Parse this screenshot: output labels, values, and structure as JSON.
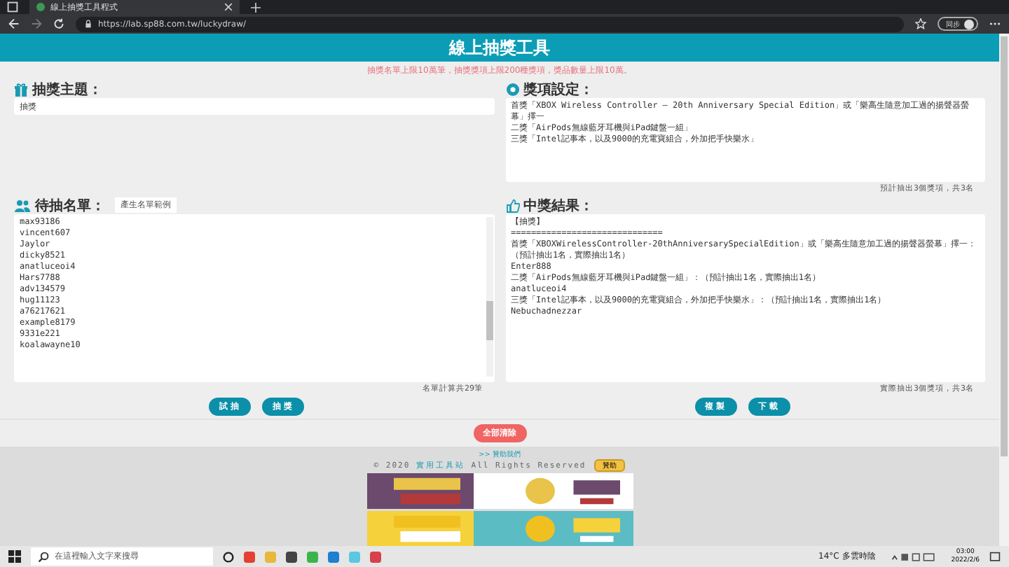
{
  "browser": {
    "tab_title": "線上抽獎工具程式",
    "url": "https://lab.sp88.com.tw/luckydraw/",
    "profile_label": "同步"
  },
  "header": {
    "title": "線上抽獎工具"
  },
  "notice": "抽獎名單上限10萬筆，抽獎獎項上限200種獎項，獎品數量上限10萬。",
  "topic": {
    "heading": "抽獎主題：",
    "value": "抽獎"
  },
  "prizes": {
    "heading": "獎項設定：",
    "lines": [
      "首獎「XBOX Wireless Controller – 20th Anniversary Special Edition」或「樂高生隨意加工過的揚聲器螢幕」擇一",
      "二獎「AirPods無線藍牙耳機與iPad鍵盤一組」",
      "三獎「Intel記事本，以及9000的充電寶組合，外加把手快樂水」"
    ],
    "summary": "預計抽出3個獎項，共3名"
  },
  "entrants": {
    "heading": "待抽名單：",
    "sample_button": "產生名單範例",
    "names": [
      "max93186",
      "vincent607",
      "Jaylor",
      "dicky8521",
      "anatluceoi4",
      "Hars7788",
      "adv134579",
      "hug11123",
      "a76217621",
      "example8179",
      "9331e221",
      "koalawayne10"
    ],
    "summary": "名單計算共29筆"
  },
  "results": {
    "heading": "中獎結果：",
    "lines": [
      "【抽獎】",
      "==============================",
      "首獎「XBOXWirelessController-20thAnniversarySpecialEdition」或「樂高生隨意加工過的揚聲器螢幕」擇一：（預計抽出1名，實際抽出1名）",
      "Enter888",
      "二獎「AirPods無線藍牙耳機與iPad鍵盤一組」：（預計抽出1名，實際抽出1名）",
      "anatluceoi4",
      "三獎「Intel記事本，以及9000的充電寶組合，外加把手快樂水」：（預計抽出1名，實際抽出1名）",
      "Nebuchadnezzar"
    ],
    "summary": "實際抽出3個獎項，共3名"
  },
  "buttons_left": [
    "試抽",
    "抽獎"
  ],
  "buttons_right": [
    "複製",
    "下載"
  ],
  "clear_button": "全部清除",
  "footer": {
    "link": ">> 贊助我們",
    "copyright_prefix": "© 2020 ",
    "site_name": "實用工具站",
    "copyright_suffix": " All Rights Reserved",
    "donate_button": "贊助"
  },
  "ads": [
    {
      "kind": "picture"
    },
    {
      "kind": "picture"
    }
  ],
  "taskbar": {
    "search_placeholder": "在這裡輸入文字來搜尋",
    "weather": "14°C 多雲時陰",
    "time": "03:00",
    "date": "2022/2/6"
  }
}
